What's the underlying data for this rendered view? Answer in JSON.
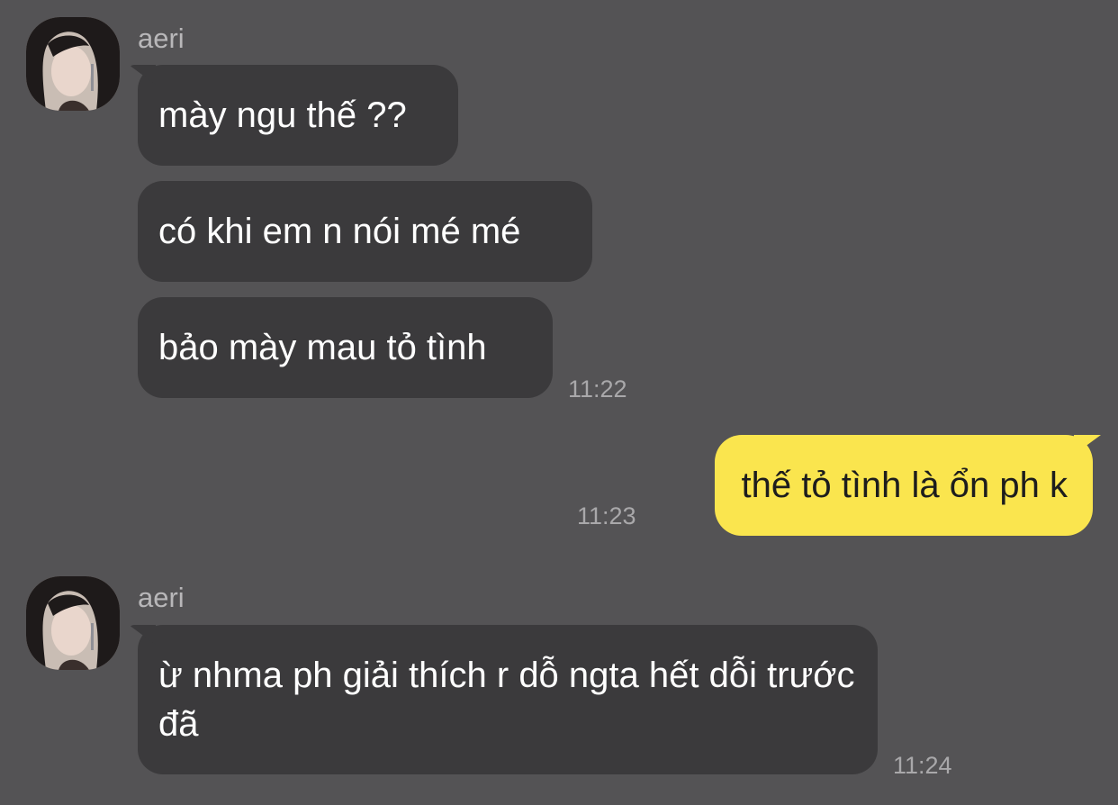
{
  "messages": [
    {
      "sender": "aeri",
      "avatar": "profile-photo",
      "bubbles": [
        "mày ngu thế ??",
        "có khi em n nói mé mé",
        "bảo mày mau tỏ tình"
      ],
      "time": "11:22"
    },
    {
      "sender": "me",
      "bubbles": [
        "thế tỏ tình là ổn ph k"
      ],
      "time": "11:23"
    },
    {
      "sender": "aeri",
      "avatar": "profile-photo",
      "bubbles": [
        "ừ nhma ph giải thích r dỗ ngta hết dỗi trước đã"
      ],
      "time": "11:24"
    }
  ],
  "colors": {
    "background": "#545355",
    "incoming_bubble": "#3b3a3c",
    "outgoing_bubble": "#fae54e",
    "timestamp": "#a9a8aa"
  }
}
